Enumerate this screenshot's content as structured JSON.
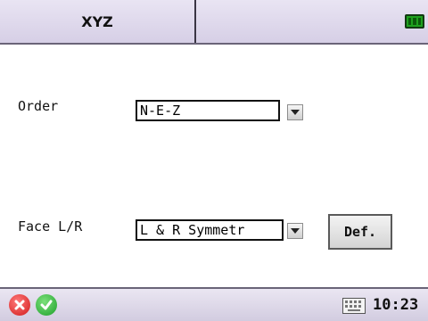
{
  "header": {
    "title": "XYZ",
    "battery_icon": "battery-full-icon"
  },
  "form": {
    "order": {
      "label": "Order",
      "value": "N-E-Z"
    },
    "face": {
      "label": "Face L/R",
      "value": "L & R Symmetr"
    },
    "default_button_label": "Def."
  },
  "status_bar": {
    "close_icon": "close-icon",
    "ok_icon": "check-icon",
    "keyboard_icon": "keyboard-icon",
    "time": "10:23"
  },
  "colors": {
    "bar_background": "#ddd6ea",
    "battery_green": "#1fa11f",
    "close_red": "#d11a1a",
    "ok_green": "#1e9f2a"
  }
}
